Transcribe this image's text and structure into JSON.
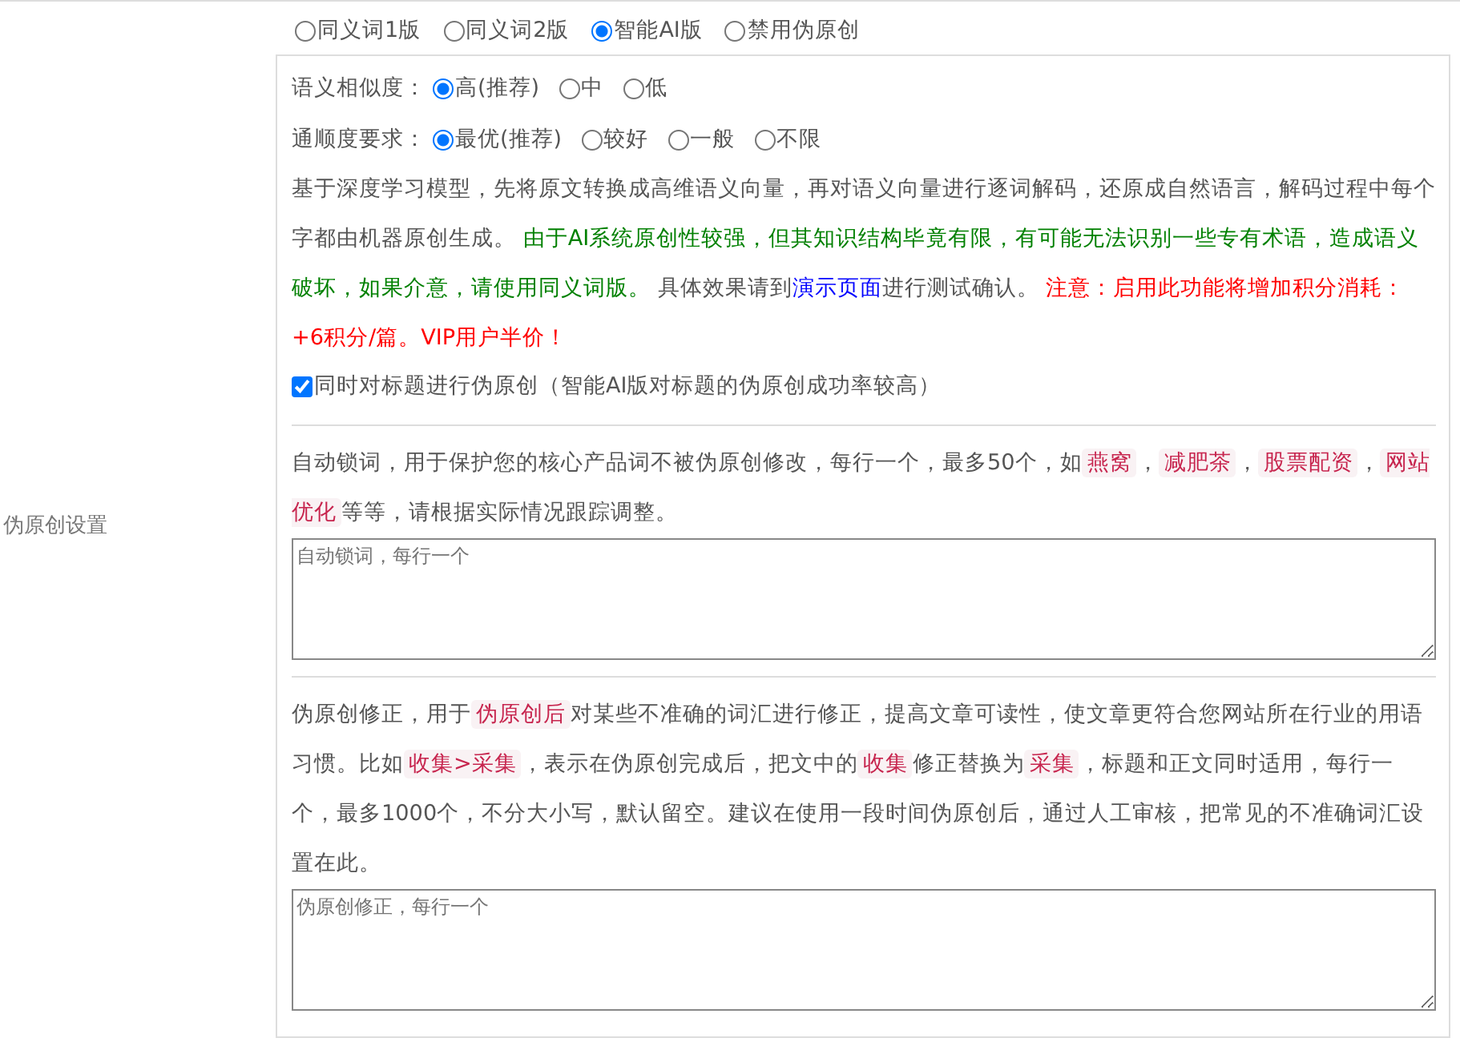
{
  "mode_options": [
    {
      "label": "同义词1版",
      "selected": false
    },
    {
      "label": "同义词2版",
      "selected": false
    },
    {
      "label": "智能AI版",
      "selected": true
    },
    {
      "label": "禁用伪原创",
      "selected": false
    }
  ],
  "side_label": "伪原创设置",
  "settings": [
    {
      "label": "语义相似度：",
      "options": [
        {
          "label": "高(推荐)",
          "selected": true
        },
        {
          "label": "中",
          "selected": false
        },
        {
          "label": "低",
          "selected": false
        }
      ]
    },
    {
      "label": "通顺度要求：",
      "options": [
        {
          "label": "最优(推荐)",
          "selected": true
        },
        {
          "label": "较好",
          "selected": false
        },
        {
          "label": "一般",
          "selected": false
        },
        {
          "label": "不限",
          "selected": false
        }
      ]
    }
  ],
  "description": [
    {
      "kind": "plain",
      "text": "基于深度学习模型，先将原文转换成高维语义向量，再对语义向量进行逐词解码，还原成自然语言，解码过程中每个字都由机器原创生成。 "
    },
    {
      "kind": "green",
      "text": "由于AI系统原创性较强，但其知识结构毕竟有限，有可能无法识别一些专有术语，造成语义破坏，如果介意，请使用同义词版。"
    },
    {
      "kind": "plain",
      "text": " 具体效果请到"
    },
    {
      "kind": "link",
      "text": "演示页面"
    },
    {
      "kind": "plain",
      "text": "进行测试确认。 "
    },
    {
      "kind": "red",
      "text": "注意：启用此功能将增加积分消耗：+6积分/篇。VIP用户半价！"
    }
  ],
  "title_checkbox": {
    "label": "同时对标题进行伪原创（智能AI版对标题的伪原创成功率较高）",
    "checked": true
  },
  "lock_words": {
    "segments": [
      {
        "kind": "plain",
        "text": "自动锁词，用于保护您的核心产品词不被伪原创修改，每行一个，最多50个，如"
      },
      {
        "kind": "tag",
        "text": "燕窝"
      },
      {
        "kind": "plain",
        "text": "，"
      },
      {
        "kind": "tag",
        "text": "减肥茶"
      },
      {
        "kind": "plain",
        "text": "，"
      },
      {
        "kind": "tag",
        "text": "股票配资"
      },
      {
        "kind": "plain",
        "text": "，"
      },
      {
        "kind": "tag",
        "text": "网站优化"
      },
      {
        "kind": "plain",
        "text": "等等，请根据实际情况跟踪调整。"
      }
    ],
    "placeholder": "自动锁词，每行一个"
  },
  "correction": {
    "segments": [
      {
        "kind": "plain",
        "text": "伪原创修正，用于"
      },
      {
        "kind": "tag",
        "text": "伪原创后"
      },
      {
        "kind": "plain",
        "text": "对某些不准确的词汇进行修正，提高文章可读性，使文章更符合您网站所在行业的用语习惯。比如"
      },
      {
        "kind": "tag",
        "text": "收集>采集"
      },
      {
        "kind": "plain",
        "text": "，表示在伪原创完成后，把文中的"
      },
      {
        "kind": "tag",
        "text": "收集"
      },
      {
        "kind": "plain",
        "text": "修正替换为"
      },
      {
        "kind": "tag",
        "text": "采集"
      },
      {
        "kind": "plain",
        "text": "，标题和正文同时适用，每行一个，最多1000个，不分大小写，默认留空。建议在使用一段时间伪原创后，通过人工审核，把常见的不准确词汇设置在此。"
      }
    ],
    "placeholder": "伪原创修正，每行一个"
  }
}
